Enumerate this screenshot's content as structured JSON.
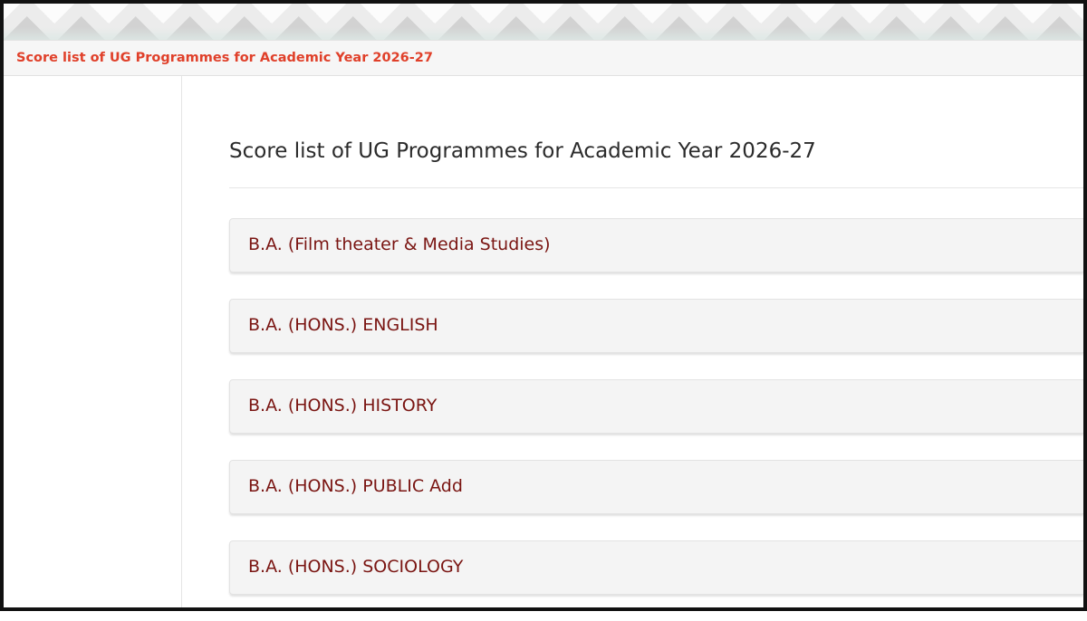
{
  "breadcrumb": {
    "label": "Score list of UG Programmes for Academic Year 2026-27"
  },
  "page": {
    "title": "Score list of UG Programmes for Academic Year 2026-27"
  },
  "programmes": [
    {
      "label": "B.A. (Film theater & Media Studies)"
    },
    {
      "label": "B.A. (HONS.) ENGLISH"
    },
    {
      "label": "B.A. (HONS.) HISTORY"
    },
    {
      "label": "B.A. (HONS.) PUBLIC Add"
    },
    {
      "label": "B.A. (HONS.) SOCIOLOGY"
    }
  ],
  "colors": {
    "breadcrumb_text": "#e0402a",
    "programme_text": "#7a1512",
    "panel_background": "#f4f4f4"
  }
}
